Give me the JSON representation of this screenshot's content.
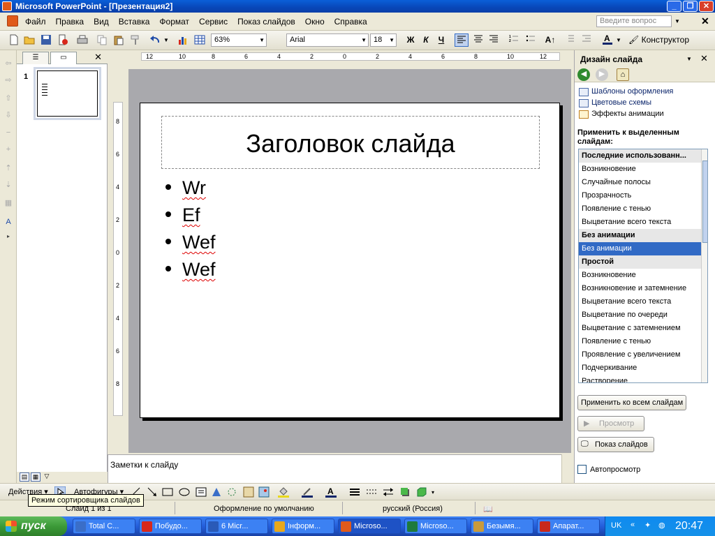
{
  "window": {
    "title": "Microsoft PowerPoint - [Презентация2]",
    "help_placeholder": "Введите вопрос"
  },
  "menu": [
    "Файл",
    "Правка",
    "Вид",
    "Вставка",
    "Формат",
    "Сервис",
    "Показ слайдов",
    "Окно",
    "Справка"
  ],
  "toolbar": {
    "zoom": "63%",
    "font": "Arial",
    "size": "18",
    "bold": "Ж",
    "italic": "К",
    "underline": "Ч",
    "designer": "Конструктор"
  },
  "ruler": {
    "h_ticks": [
      "12",
      "10",
      "8",
      "6",
      "4",
      "2",
      "0",
      "2",
      "4",
      "6",
      "8",
      "10",
      "12"
    ],
    "v_ticks": [
      "8",
      "6",
      "4",
      "2",
      "0",
      "2",
      "4",
      "6",
      "8"
    ]
  },
  "slides_pane": {
    "slide_number": "1"
  },
  "slide": {
    "title": "Заголовок слайда",
    "bullets": [
      "Wr",
      "Ef",
      "Wef",
      "Wef"
    ]
  },
  "notes": {
    "placeholder": "Заметки к слайду"
  },
  "task_pane": {
    "title": "Дизайн слайда",
    "links": [
      "Шаблоны оформления",
      "Цветовые схемы",
      "Эффекты анимации"
    ],
    "apply_label": "Применить к выделенным слайдам:",
    "animations": [
      {
        "label": "Последние использованн...",
        "kind": "header"
      },
      {
        "label": "Возникновение",
        "kind": "item"
      },
      {
        "label": "Случайные полосы",
        "kind": "item"
      },
      {
        "label": "Прозрачность",
        "kind": "item"
      },
      {
        "label": "Появление с тенью",
        "kind": "item"
      },
      {
        "label": "Выцветание всего текста",
        "kind": "item"
      },
      {
        "label": "Без анимации",
        "kind": "header"
      },
      {
        "label": "Без анимации",
        "kind": "selected"
      },
      {
        "label": "Простой",
        "kind": "header"
      },
      {
        "label": "Возникновение",
        "kind": "item"
      },
      {
        "label": "Возникновение и затемнение",
        "kind": "item"
      },
      {
        "label": "Выцветание всего текста",
        "kind": "item"
      },
      {
        "label": "Выцветание по очереди",
        "kind": "item"
      },
      {
        "label": "Выцветание с затемнением",
        "kind": "item"
      },
      {
        "label": "Появление с тенью",
        "kind": "item"
      },
      {
        "label": "Проявление с увеличением",
        "kind": "item"
      },
      {
        "label": "Подчеркивание",
        "kind": "item"
      },
      {
        "label": "Растворение",
        "kind": "item"
      }
    ],
    "apply_all": "Применить ко всем слайдам",
    "preview": "Просмотр",
    "slideshow": "Показ слайдов",
    "autopreview": "Автопросмотр"
  },
  "drawbar": {
    "actions": "Действия",
    "autoshapes": "Автофигуры"
  },
  "tooltip": "Режим сортировщика слайдов",
  "status": {
    "slide": "Слайд 1 из 1",
    "design": "Оформление по умолчанию",
    "language": "русский (Россия)"
  },
  "taskbar": {
    "start": "пуск",
    "tasks": [
      {
        "label": "Total C...",
        "color": "#3a6ec8"
      },
      {
        "label": "Побудо...",
        "color": "#d8281c"
      },
      {
        "label": "6 Micr...",
        "color": "#2a5ab8"
      },
      {
        "label": "Інформ...",
        "color": "#e8a81c"
      },
      {
        "label": "Microso...",
        "color": "#e05a1a",
        "active": true
      },
      {
        "label": "Microso...",
        "color": "#1e7a3c"
      },
      {
        "label": "Безымя...",
        "color": "#c89a3c"
      },
      {
        "label": "Апарат...",
        "color": "#c8281c"
      }
    ],
    "lang": "UK",
    "clock": "20:47"
  }
}
